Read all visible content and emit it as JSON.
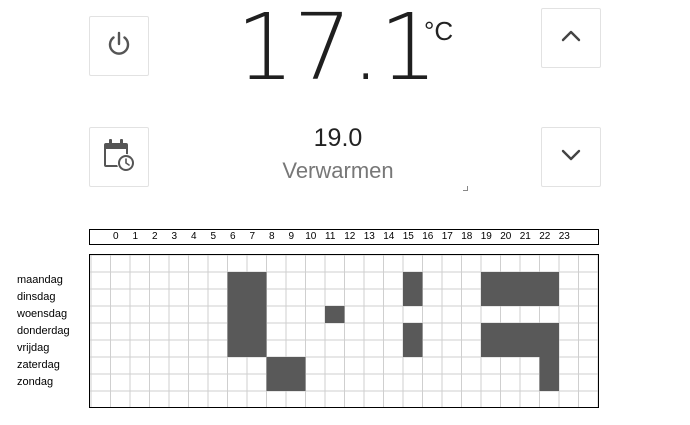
{
  "thermostat": {
    "current_temperature": "17.1",
    "unit": "°C",
    "setpoint": "19.0",
    "mode": "Verwarmen"
  },
  "icons": {
    "power": "power-icon",
    "schedule": "calendar-clock-icon",
    "up": "chevron-up-icon",
    "down": "chevron-down-icon"
  },
  "colors": {
    "active_cell": "#595959",
    "grid_line": "#cfcfcf",
    "icon": "#555555"
  },
  "schedule": {
    "hours": [
      "0",
      "1",
      "2",
      "3",
      "4",
      "5",
      "6",
      "7",
      "8",
      "9",
      "10",
      "11",
      "12",
      "13",
      "14",
      "15",
      "16",
      "17",
      "18",
      "19",
      "20",
      "21",
      "22",
      "23"
    ],
    "days": [
      "maandag",
      "dinsdag",
      "woensdag",
      "donderdag",
      "vrijdag",
      "zaterdag",
      "zondag"
    ],
    "active": [
      [
        6,
        7,
        15,
        19,
        20,
        21,
        22
      ],
      [
        6,
        7,
        15,
        19,
        20,
        21,
        22
      ],
      [
        6,
        7,
        11
      ],
      [
        6,
        7,
        15,
        19,
        20,
        21,
        22
      ],
      [
        6,
        7,
        15,
        19,
        20,
        21,
        22
      ],
      [
        8,
        9,
        22
      ],
      [
        8,
        9,
        22
      ]
    ]
  }
}
